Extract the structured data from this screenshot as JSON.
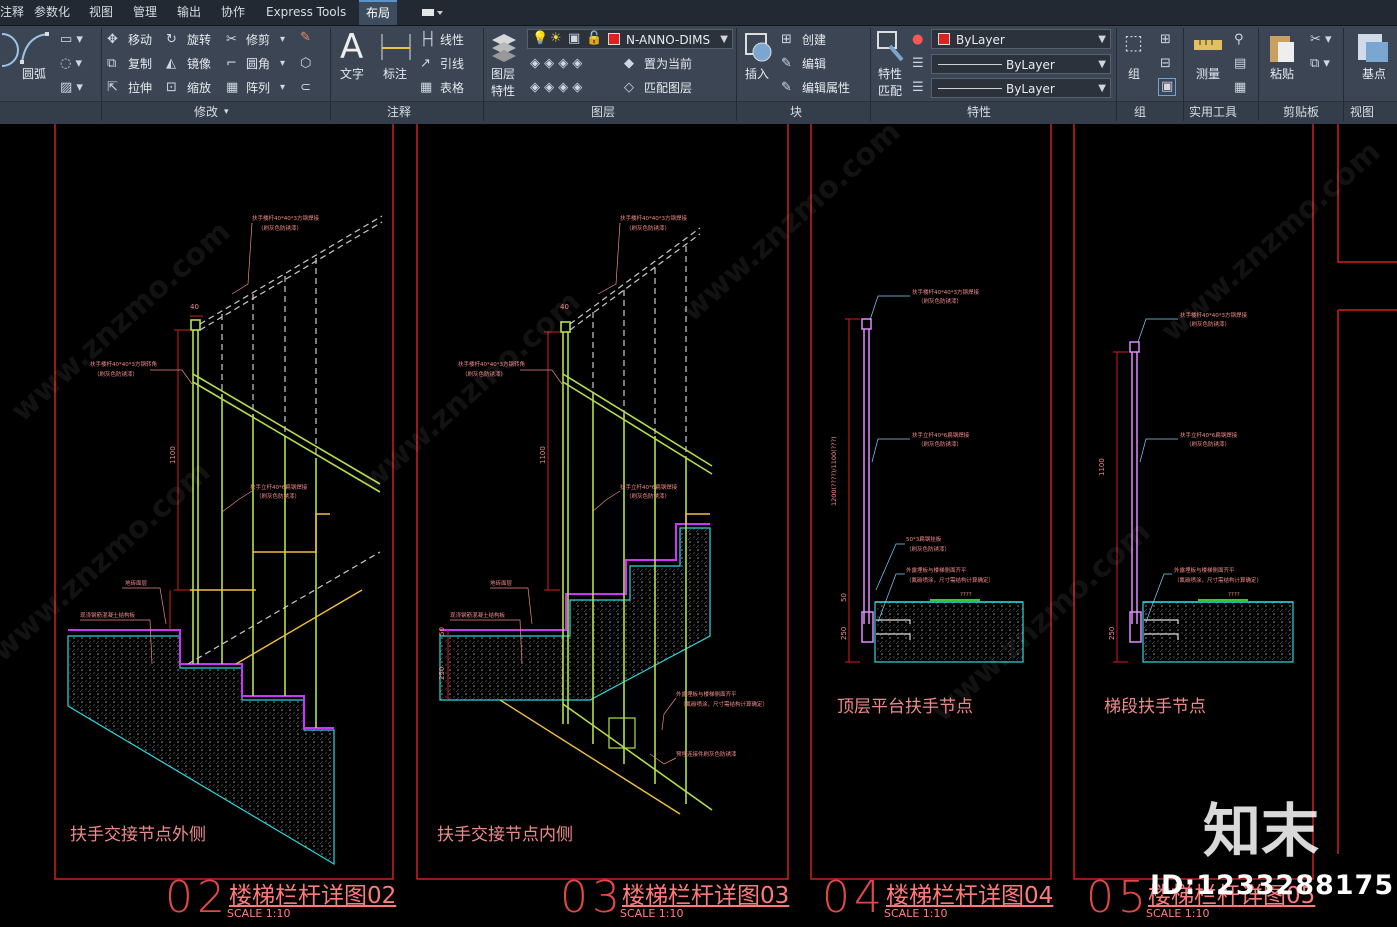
{
  "tabs": [
    "注释",
    "参数化",
    "视图",
    "管理",
    "输出",
    "协作",
    "Express Tools",
    "布局"
  ],
  "ribbon": {
    "draw": {
      "arc": "圆弧"
    },
    "modify": {
      "move": "移动",
      "rotate": "旋转",
      "trim": "修剪",
      "copy": "复制",
      "mirror": "镜像",
      "fillet": "圆角",
      "stretch": "拉伸",
      "scale": "缩放",
      "array": "阵列",
      "group_label": "修改"
    },
    "annotation": {
      "text": "文字",
      "dimension": "标注",
      "linear": "线性",
      "leader": "引线",
      "table": "表格",
      "group_label": "注释"
    },
    "layers": {
      "layer_properties": "图层\n特性",
      "layer_properties_1": "图层",
      "layer_properties_2": "特性",
      "current_layer": "N-ANNO-DIMS",
      "set_current": "置为当前",
      "match_layer": "匹配图层",
      "group_label": "图层"
    },
    "block": {
      "insert": "插入",
      "create": "创建",
      "edit": "编辑",
      "edit_attributes": "编辑属性",
      "group_label": "块"
    },
    "properties": {
      "match_1": "特性",
      "match_2": "匹配",
      "color": "ByLayer",
      "linetype": "ByLayer",
      "lineweight": "ByLayer",
      "group_label": "特性"
    },
    "groups": {
      "group": "组",
      "group_label": "组"
    },
    "utilities": {
      "measure": "测量",
      "group_label": "实用工具"
    },
    "clipboard": {
      "paste": "粘贴",
      "group_label": "剪贴板"
    },
    "view": {
      "base": "基点",
      "group_label": "视图"
    }
  },
  "colors": {
    "accent": "#5b93c8",
    "frame": "#d01f1f",
    "title": "#ff7a7a",
    "tab_bg": "#222933",
    "ribbon_bg": "#3b4554"
  },
  "drawing": {
    "watermark": "www.znzmo.com",
    "dims": {
      "d40": "40",
      "d1100": "1100",
      "d50": "50",
      "d250": "250",
      "d1200": "1200(????)/1100(???)"
    },
    "notes": {
      "handrail": "扶手楼杆40*40*3方钢焊接",
      "paint": "（刷灰色防锈漆）",
      "corner": "扶手楼杆40*40*3方钢转角",
      "post": "扶手立杆40*6扁钢焊接",
      "finish": "地砖面层",
      "concrete": "现浇钢筋混凝土结构板",
      "plate": "50*3扁钢挂板",
      "flush": "外露埋板与楼梯侧面齐平",
      "flush2": "（氟碳喷涂，尺寸需结构计算确定）",
      "embed": "预埋连接件刷灰色防锈漆",
      "qmark": "????"
    },
    "panels": [
      {
        "caption": "扶手交接节点外侧",
        "number": "02",
        "title": "楼梯栏杆详图02",
        "scale": "SCALE 1:10"
      },
      {
        "caption": "扶手交接节点内侧",
        "number": "03",
        "title": "楼梯栏杆详图03",
        "scale": "SCALE 1:10"
      },
      {
        "caption": "顶层平台扶手节点",
        "number": "04",
        "title": "楼梯栏杆详图04",
        "scale": "SCALE 1:10"
      },
      {
        "caption": "梯段扶手节点",
        "number": "05",
        "title": "楼梯栏杆详图05",
        "scale": "SCALE 1:10"
      }
    ]
  },
  "logo": "知末",
  "image_id": "ID:1233288175"
}
